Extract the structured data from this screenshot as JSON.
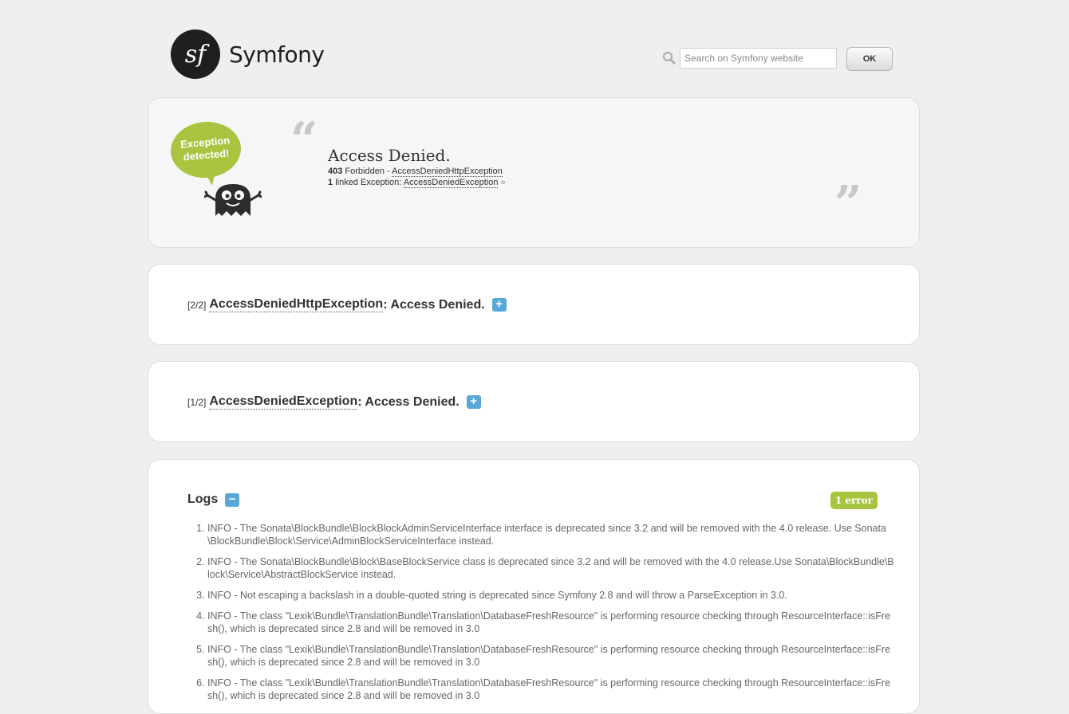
{
  "header": {
    "logo_glyph": "sf",
    "logo_text": "Symfony",
    "search_placeholder": "Search on Symfony website",
    "ok_label": "OK"
  },
  "exception": {
    "bubble_line1": "Exception",
    "bubble_line2": "detected!",
    "title": "Access Denied.",
    "status_code": "403",
    "status_text": "Forbidden - ",
    "exception_class": "AccessDeniedHttpException",
    "linked_count": "1",
    "linked_text": "linked Exception: ",
    "linked_class": "AccessDeniedException",
    "linked_arrow": "»"
  },
  "traces": [
    {
      "count": "[2/2]",
      "class": "AccessDeniedHttpException",
      "message": ": Access Denied.",
      "toggle": "+"
    },
    {
      "count": "[1/2]",
      "class": "AccessDeniedException",
      "message": ": Access Denied.",
      "toggle": "+"
    }
  ],
  "logs": {
    "title": "Logs",
    "toggle": "−",
    "error_badge": "1 error",
    "entries": [
      "INFO - The Sonata\\BlockBundle\\BlockBlockAdminServiceInterface interface is deprecated since 3.2 and will be removed with the 4.0 release. Use Sonata\\BlockBundle\\Block\\Service\\AdminBlockServiceInterface instead.",
      "INFO - The Sonata\\BlockBundle\\Block\\BaseBlockService class is deprecated since 3.2 and will be removed with the 4.0 release.Use Sonata\\BlockBundle\\Block\\Service\\AbstractBlockService instead.",
      "INFO - Not escaping a backslash in a double-quoted string is deprecated since Symfony 2.8 and will throw a ParseException in 3.0.",
      "INFO - The class \"Lexik\\Bundle\\TranslationBundle\\Translation\\DatabaseFreshResource\" is performing resource checking through ResourceInterface::isFresh(), which is deprecated since 2.8 and will be removed in 3.0",
      "INFO - The class \"Lexik\\Bundle\\TranslationBundle\\Translation\\DatabaseFreshResource\" is performing resource checking through ResourceInterface::isFresh(), which is deprecated since 2.8 and will be removed in 3.0",
      "INFO - The class \"Lexik\\Bundle\\TranslationBundle\\Translation\\DatabaseFreshResource\" is performing resource checking through ResourceInterface::isFresh(), which is deprecated since 2.8 and will be removed in 3.0"
    ]
  },
  "colors": {
    "accent_green": "#a8c440",
    "toggle_blue": "#57a8d6",
    "page_bg": "#efefef"
  }
}
